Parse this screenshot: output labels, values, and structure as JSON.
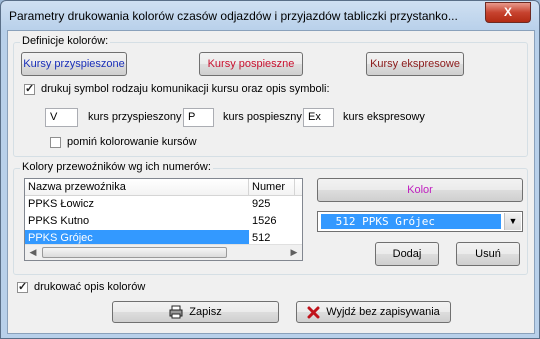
{
  "window": {
    "title": "Parametry drukowania kolorów czasów odjazdów i przyjazdów tabliczki przystanko...",
    "close_label": "X"
  },
  "definitions": {
    "group_label": "Definicje kolorów:",
    "btn_accelerated": "Kursy przyspieszone",
    "btn_fast": "Kursy pospieszne",
    "btn_express": "Kursy ekspresowe",
    "print_symbol_label": "drukuj symbol rodzaju komunikacji kursu oraz opis symboli:",
    "print_symbol_checked": true,
    "symbol_accelerated_value": "V",
    "symbol_accelerated_label": "kurs przyspieszony",
    "symbol_fast_value": "P",
    "symbol_fast_label": "kurs pospieszny",
    "symbol_express_value": "Ex",
    "symbol_express_label": "kurs ekspresowy",
    "skip_coloring_label": "pomiń kolorowanie kursów",
    "skip_coloring_checked": false,
    "colors": {
      "accelerated": "#1a2fb8",
      "fast": "#c8102e",
      "express": "#8b1a1a"
    }
  },
  "carriers": {
    "group_label": "Kolory przewoźników wg ich numerów:",
    "columns": [
      "Nazwa przewoźnika",
      "Numer"
    ],
    "rows": [
      {
        "name": "PPKS Łowicz",
        "number": "925"
      },
      {
        "name": "PPKS Kutno",
        "number": "1526"
      },
      {
        "name": "PPKS Grójec",
        "number": "512"
      }
    ],
    "selected_row": 2,
    "color_button": "Kolor",
    "color_button_text_color": "#c020c0",
    "select_value": " 512 PPKS Grójec",
    "add_button": "Dodaj",
    "remove_button": "Usuń"
  },
  "print_legend_label": "drukować opis kolorów",
  "print_legend_checked": true,
  "footer": {
    "save_label": "Zapisz",
    "exit_label": "Wyjdź bez zapisywania"
  }
}
